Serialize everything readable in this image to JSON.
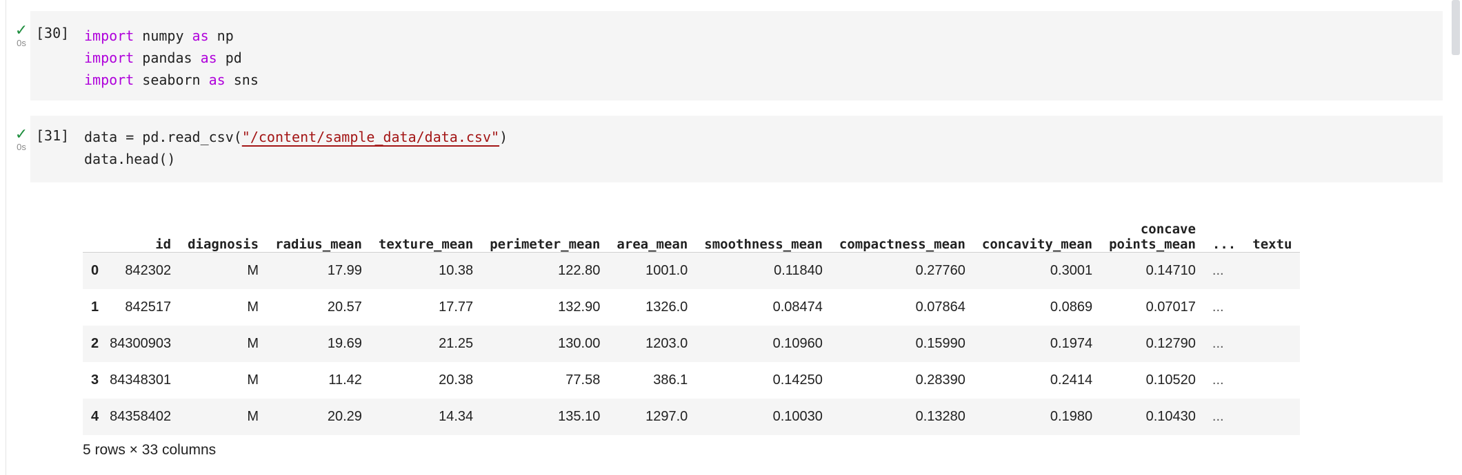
{
  "cells": [
    {
      "status": {
        "icon": "checkmark-icon",
        "time": "0s"
      },
      "prompt": "[30]",
      "lines": [
        [
          {
            "t": "import",
            "k": "kw"
          },
          {
            "t": " numpy ",
            "k": ""
          },
          {
            "t": "as",
            "k": "kw"
          },
          {
            "t": " np",
            "k": ""
          }
        ],
        [
          {
            "t": "import",
            "k": "kw"
          },
          {
            "t": " pandas ",
            "k": ""
          },
          {
            "t": "as",
            "k": "kw"
          },
          {
            "t": " pd",
            "k": ""
          }
        ],
        [
          {
            "t": "import",
            "k": "kw"
          },
          {
            "t": " seaborn ",
            "k": ""
          },
          {
            "t": "as",
            "k": "kw"
          },
          {
            "t": " sns",
            "k": ""
          }
        ]
      ]
    },
    {
      "status": {
        "icon": "checkmark-icon",
        "time": "0s"
      },
      "prompt": "[31]",
      "lines": [
        [
          {
            "t": "data = pd.read_csv(",
            "k": ""
          },
          {
            "t": "\"/content/sample_data/data.csv\"",
            "k": "str"
          },
          {
            "t": ")",
            "k": ""
          }
        ],
        [
          {
            "t": "data.head()",
            "k": ""
          }
        ]
      ]
    }
  ],
  "dataframe": {
    "columns": [
      "",
      "id",
      "diagnosis",
      "radius_mean",
      "texture_mean",
      "perimeter_mean",
      "area_mean",
      "smoothness_mean",
      "compactness_mean",
      "concavity_mean",
      "concave\npoints_mean",
      "...",
      "textu"
    ],
    "rows": [
      [
        "0",
        "842302",
        "M",
        "17.99",
        "10.38",
        "122.80",
        "1001.0",
        "0.11840",
        "0.27760",
        "0.3001",
        "0.14710",
        "...",
        ""
      ],
      [
        "1",
        "842517",
        "M",
        "20.57",
        "17.77",
        "132.90",
        "1326.0",
        "0.08474",
        "0.07864",
        "0.0869",
        "0.07017",
        "...",
        ""
      ],
      [
        "2",
        "84300903",
        "M",
        "19.69",
        "21.25",
        "130.00",
        "1203.0",
        "0.10960",
        "0.15990",
        "0.1974",
        "0.12790",
        "...",
        ""
      ],
      [
        "3",
        "84348301",
        "M",
        "11.42",
        "20.38",
        "77.58",
        "386.1",
        "0.14250",
        "0.28390",
        "0.2414",
        "0.10520",
        "...",
        ""
      ],
      [
        "4",
        "84358402",
        "M",
        "20.29",
        "14.34",
        "135.10",
        "1297.0",
        "0.10030",
        "0.13280",
        "0.1980",
        "0.10430",
        "...",
        ""
      ]
    ],
    "footer": "5 rows × 33 columns"
  },
  "colors": {
    "keyword": "#af00db",
    "string": "#a31515",
    "check": "#1e8e3e",
    "cell_bg": "#f5f5f5"
  }
}
